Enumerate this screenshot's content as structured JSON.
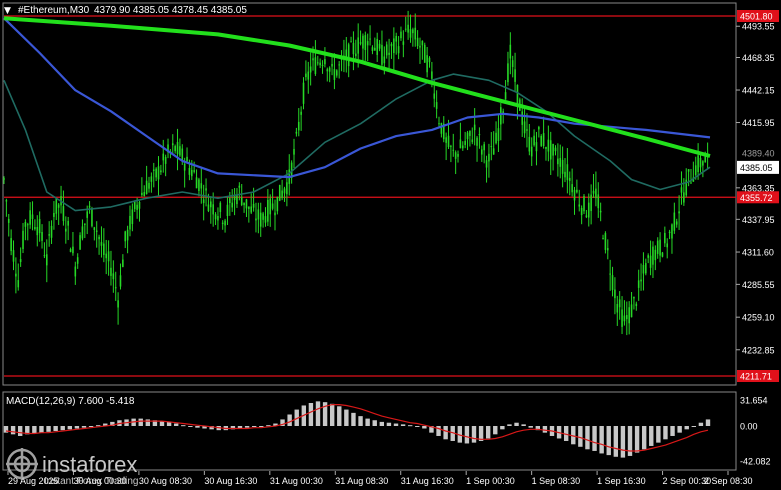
{
  "header": {
    "symbol": "#Ethereum,M30",
    "ohlc": "4379.90 4385.05 4378.45 4385.05"
  },
  "price_axis": {
    "ticks": [
      "4493.55",
      "4468.35",
      "4442.15",
      "4415.95",
      "4363.35",
      "4337.95",
      "4311.60",
      "4285.55",
      "4259.10",
      "4232.85"
    ],
    "ticks_values": [
      4493.55,
      4468.35,
      4442.15,
      4415.95,
      4363.35,
      4337.95,
      4311.6,
      4285.55,
      4259.1,
      4232.85
    ],
    "partial_label": "4389.40",
    "current_price_label": "4385.05",
    "current_price": 4385.05,
    "level_labels": [
      "4501.80",
      "4355.72",
      "4211.71"
    ],
    "level_values": [
      4501.8,
      4355.72,
      4211.71
    ]
  },
  "macd": {
    "label": "MACD(12,26,9) 7.600 -5.418",
    "ticks": [
      "31.654",
      "0.00",
      "-42.082"
    ],
    "tick_values": [
      31.654,
      0.0,
      -42.082
    ]
  },
  "time_axis": {
    "labels": [
      "29 Aug 2025",
      "30 Aug 00:30",
      "30 Aug 08:30",
      "30 Aug 16:30",
      "31 Aug 00:30",
      "31 Aug 08:30",
      "31 Aug 16:30",
      "1 Sep 00:30",
      "1 Sep 08:30",
      "1 Sep 16:30",
      "2 Sep 00:30",
      "2 Sep 08:30"
    ]
  },
  "watermark": {
    "brand": "instaforex",
    "tagline": "Instant Forex Trading"
  },
  "colors": {
    "background": "#000000",
    "candle": "#26d926",
    "ma_fast": "#1f6b62",
    "ma_mid": "#3a57d6",
    "ma_slow": "#22e01c",
    "level_line": "#e0101a",
    "macd_hist": "#c8c8c8",
    "macd_signal": "#d81818",
    "axis_text": "#ffffff"
  },
  "chart_data": {
    "type": "candlestick",
    "symbol": "#Ethereum",
    "timeframe": "M30",
    "ylim": [
      4211.71,
      4501.8
    ],
    "horizontal_levels": [
      4501.8,
      4355.72,
      4211.71
    ],
    "close_path": [
      [
        0,
        4370
      ],
      [
        1,
        4320
      ],
      [
        2,
        4290
      ],
      [
        3,
        4335
      ],
      [
        4,
        4340
      ],
      [
        5,
        4330
      ],
      [
        6,
        4305
      ],
      [
        7,
        4345
      ],
      [
        8,
        4350
      ],
      [
        9,
        4330
      ],
      [
        10,
        4300
      ],
      [
        11,
        4330
      ],
      [
        12,
        4345
      ],
      [
        13,
        4330
      ],
      [
        14,
        4310
      ],
      [
        15,
        4300
      ],
      [
        16,
        4275
      ],
      [
        17,
        4320
      ],
      [
        18,
        4340
      ],
      [
        19,
        4355
      ],
      [
        20,
        4365
      ],
      [
        21,
        4370
      ],
      [
        22,
        4380
      ],
      [
        23,
        4390
      ],
      [
        24,
        4395
      ],
      [
        25,
        4388
      ],
      [
        26,
        4380
      ],
      [
        27,
        4372
      ],
      [
        28,
        4360
      ],
      [
        29,
        4350
      ],
      [
        30,
        4345
      ],
      [
        31,
        4340
      ],
      [
        32,
        4352
      ],
      [
        33,
        4360
      ],
      [
        34,
        4350
      ],
      [
        35,
        4342
      ],
      [
        36,
        4338
      ],
      [
        37,
        4345
      ],
      [
        38,
        4350
      ],
      [
        39,
        4360
      ],
      [
        40,
        4370
      ],
      [
        41,
        4400
      ],
      [
        42,
        4440
      ],
      [
        43,
        4460
      ],
      [
        44,
        4465
      ],
      [
        45,
        4470
      ],
      [
        46,
        4455
      ],
      [
        47,
        4460
      ],
      [
        48,
        4468
      ],
      [
        49,
        4475
      ],
      [
        50,
        4480
      ],
      [
        51,
        4485
      ],
      [
        52,
        4478
      ],
      [
        53,
        4470
      ],
      [
        54,
        4472
      ],
      [
        55,
        4478
      ],
      [
        56,
        4485
      ],
      [
        57,
        4490
      ],
      [
        58,
        4482
      ],
      [
        59,
        4470
      ],
      [
        60,
        4455
      ],
      [
        61,
        4420
      ],
      [
        62,
        4400
      ],
      [
        63,
        4390
      ],
      [
        64,
        4395
      ],
      [
        65,
        4400
      ],
      [
        66,
        4410
      ],
      [
        67,
        4395
      ],
      [
        68,
        4385
      ],
      [
        69,
        4400
      ],
      [
        70,
        4430
      ],
      [
        71,
        4470
      ],
      [
        72,
        4440
      ],
      [
        73,
        4410
      ],
      [
        74,
        4395
      ],
      [
        75,
        4405
      ],
      [
        76,
        4400
      ],
      [
        77,
        4390
      ],
      [
        78,
        4385
      ],
      [
        79,
        4375
      ],
      [
        80,
        4362
      ],
      [
        81,
        4350
      ],
      [
        82,
        4345
      ],
      [
        83,
        4360
      ],
      [
        84,
        4330
      ],
      [
        85,
        4300
      ],
      [
        86,
        4270
      ],
      [
        87,
        4255
      ],
      [
        88,
        4265
      ],
      [
        89,
        4280
      ],
      [
        90,
        4300
      ],
      [
        91,
        4310
      ],
      [
        92,
        4315
      ],
      [
        93,
        4320
      ],
      [
        94,
        4335
      ],
      [
        95,
        4355
      ],
      [
        96,
        4370
      ],
      [
        97,
        4380
      ],
      [
        98,
        4385
      ],
      [
        99,
        4385.05
      ]
    ],
    "ma_slow": [
      [
        0,
        4500
      ],
      [
        15,
        4494
      ],
      [
        30,
        4487
      ],
      [
        40,
        4478
      ],
      [
        50,
        4465
      ],
      [
        60,
        4448
      ],
      [
        70,
        4433
      ],
      [
        80,
        4418
      ],
      [
        90,
        4403
      ],
      [
        99,
        4389
      ]
    ],
    "ma_mid": [
      [
        0,
        4500
      ],
      [
        5,
        4472
      ],
      [
        10,
        4442
      ],
      [
        15,
        4425
      ],
      [
        20,
        4405
      ],
      [
        25,
        4385
      ],
      [
        30,
        4375
      ],
      [
        40,
        4372
      ],
      [
        45,
        4380
      ],
      [
        50,
        4395
      ],
      [
        55,
        4405
      ],
      [
        60,
        4410
      ],
      [
        65,
        4420
      ],
      [
        70,
        4423
      ],
      [
        75,
        4420
      ],
      [
        80,
        4415
      ],
      [
        90,
        4410
      ],
      [
        99,
        4404
      ]
    ],
    "ma_fast": [
      [
        0,
        4450
      ],
      [
        3,
        4410
      ],
      [
        6,
        4360
      ],
      [
        10,
        4345
      ],
      [
        15,
        4348
      ],
      [
        20,
        4355
      ],
      [
        25,
        4360
      ],
      [
        30,
        4355
      ],
      [
        35,
        4360
      ],
      [
        40,
        4375
      ],
      [
        45,
        4400
      ],
      [
        50,
        4415
      ],
      [
        55,
        4435
      ],
      [
        60,
        4450
      ],
      [
        63,
        4455
      ],
      [
        68,
        4450
      ],
      [
        72,
        4440
      ],
      [
        76,
        4425
      ],
      [
        80,
        4405
      ],
      [
        85,
        4385
      ],
      [
        88,
        4370
      ],
      [
        92,
        4362
      ],
      [
        96,
        4368
      ],
      [
        99,
        4380
      ]
    ],
    "macd_hist": [
      -8,
      -10,
      -12,
      -10,
      -9,
      -8,
      -7,
      -6,
      -5,
      -4,
      -3,
      -2,
      -1,
      1,
      3,
      5,
      7,
      8,
      9,
      9,
      8,
      7,
      6,
      5,
      3,
      1,
      -1,
      -2,
      -3,
      -4,
      -5,
      -5,
      -4,
      -3,
      -2,
      -1,
      0,
      1,
      3,
      8,
      14,
      20,
      25,
      28,
      30,
      29,
      27,
      24,
      20,
      16,
      12,
      9,
      7,
      5,
      4,
      3,
      2,
      1,
      -1,
      -3,
      -8,
      -12,
      -16,
      -18,
      -20,
      -21,
      -20,
      -18,
      -15,
      -10,
      -4,
      2,
      4,
      2,
      -2,
      -5,
      -8,
      -12,
      -15,
      -18,
      -22,
      -25,
      -28,
      -30,
      -33,
      -35,
      -37,
      -38,
      -36,
      -32,
      -28,
      -24,
      -20,
      -16,
      -12,
      -8,
      -4,
      0,
      4,
      8
    ],
    "macd_signal": [
      -6,
      -7,
      -8,
      -9,
      -9,
      -8,
      -8,
      -7,
      -6,
      -5,
      -4,
      -3,
      -2,
      -1,
      0,
      1,
      3,
      4,
      5,
      6,
      6,
      6,
      6,
      5,
      4,
      3,
      2,
      1,
      0,
      -1,
      -2,
      -3,
      -3,
      -3,
      -3,
      -2,
      -2,
      -1,
      0,
      2,
      5,
      9,
      13,
      17,
      21,
      24,
      26,
      26,
      25,
      23,
      21,
      18,
      15,
      12,
      10,
      8,
      6,
      4,
      3,
      1,
      -1,
      -3,
      -6,
      -8,
      -11,
      -13,
      -15,
      -16,
      -16,
      -15,
      -13,
      -10,
      -7,
      -5,
      -4,
      -4,
      -5,
      -6,
      -8,
      -10,
      -12,
      -14,
      -17,
      -20,
      -22,
      -25,
      -27,
      -29,
      -30,
      -30,
      -29,
      -27,
      -25,
      -23,
      -20,
      -17,
      -14,
      -10,
      -7,
      -5
    ],
    "xlabel": "",
    "ylabel": ""
  }
}
